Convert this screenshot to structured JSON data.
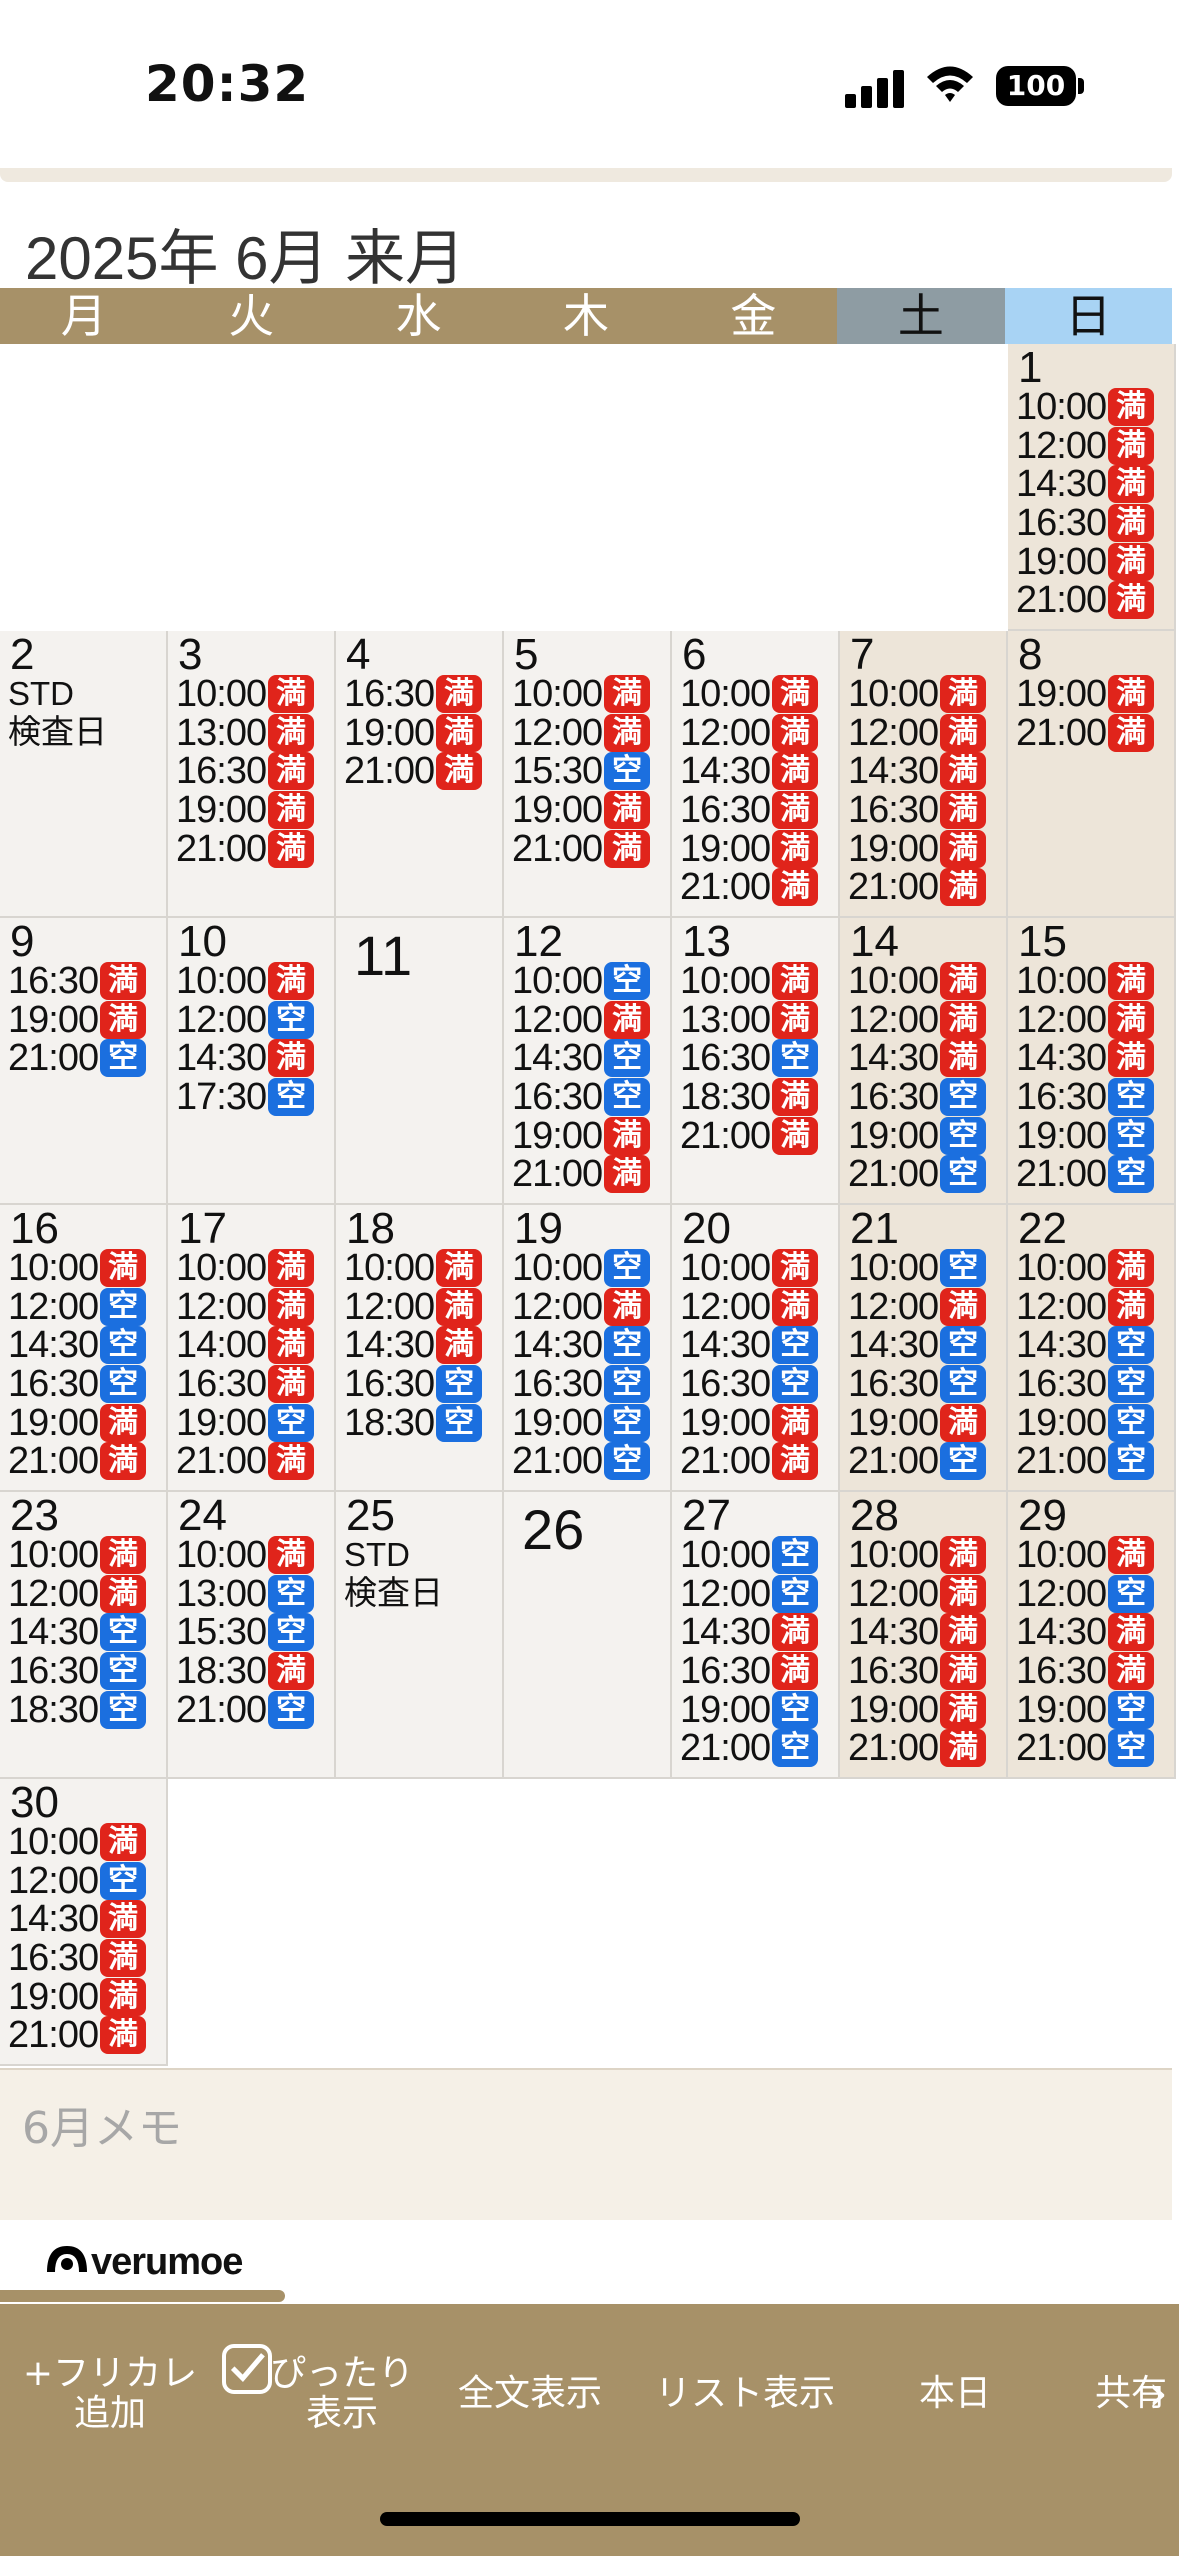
{
  "status": {
    "time": "20:32",
    "battery": "100"
  },
  "month_title": "2025年 6月 来月",
  "weekdays": [
    "月",
    "火",
    "水",
    "木",
    "金",
    "土",
    "日"
  ],
  "calendar": [
    {
      "day": "1",
      "col": 6,
      "row": 0,
      "slots": [
        [
          "10:00",
          "満"
        ],
        [
          "12:00",
          "満"
        ],
        [
          "14:30",
          "満"
        ],
        [
          "16:30",
          "満"
        ],
        [
          "19:00",
          "満"
        ],
        [
          "21:00",
          "満"
        ]
      ]
    },
    {
      "day": "2",
      "col": 0,
      "row": 1,
      "note": [
        "STD",
        "検査日"
      ],
      "slots": []
    },
    {
      "day": "3",
      "col": 1,
      "row": 1,
      "slots": [
        [
          "10:00",
          "満"
        ],
        [
          "13:00",
          "満"
        ],
        [
          "16:30",
          "満"
        ],
        [
          "19:00",
          "満"
        ],
        [
          "21:00",
          "満"
        ]
      ]
    },
    {
      "day": "4",
      "col": 2,
      "row": 1,
      "slots": [
        [
          "16:30",
          "満"
        ],
        [
          "19:00",
          "満"
        ],
        [
          "21:00",
          "満"
        ]
      ]
    },
    {
      "day": "5",
      "col": 3,
      "row": 1,
      "slots": [
        [
          "10:00",
          "満"
        ],
        [
          "12:00",
          "満"
        ],
        [
          "15:30",
          "空"
        ],
        [
          "19:00",
          "満"
        ],
        [
          "21:00",
          "満"
        ]
      ]
    },
    {
      "day": "6",
      "col": 4,
      "row": 1,
      "slots": [
        [
          "10:00",
          "満"
        ],
        [
          "12:00",
          "満"
        ],
        [
          "14:30",
          "満"
        ],
        [
          "16:30",
          "満"
        ],
        [
          "19:00",
          "満"
        ],
        [
          "21:00",
          "満"
        ]
      ]
    },
    {
      "day": "7",
      "col": 5,
      "row": 1,
      "slots": [
        [
          "10:00",
          "満"
        ],
        [
          "12:00",
          "満"
        ],
        [
          "14:30",
          "満"
        ],
        [
          "16:30",
          "満"
        ],
        [
          "19:00",
          "満"
        ],
        [
          "21:00",
          "満"
        ]
      ]
    },
    {
      "day": "8",
      "col": 6,
      "row": 1,
      "slots": [
        [
          "19:00",
          "満"
        ],
        [
          "21:00",
          "満"
        ]
      ]
    },
    {
      "day": "9",
      "col": 0,
      "row": 2,
      "slots": [
        [
          "16:30",
          "満"
        ],
        [
          "19:00",
          "満"
        ],
        [
          "21:00",
          "空"
        ]
      ]
    },
    {
      "day": "10",
      "col": 1,
      "row": 2,
      "slots": [
        [
          "10:00",
          "満"
        ],
        [
          "12:00",
          "空"
        ],
        [
          "14:30",
          "満"
        ],
        [
          "17:30",
          "空"
        ]
      ]
    },
    {
      "day": "11",
      "col": 2,
      "row": 2,
      "big": true,
      "slots": []
    },
    {
      "day": "12",
      "col": 3,
      "row": 2,
      "slots": [
        [
          "10:00",
          "空"
        ],
        [
          "12:00",
          "満"
        ],
        [
          "14:30",
          "空"
        ],
        [
          "16:30",
          "空"
        ],
        [
          "19:00",
          "満"
        ],
        [
          "21:00",
          "満"
        ]
      ]
    },
    {
      "day": "13",
      "col": 4,
      "row": 2,
      "slots": [
        [
          "10:00",
          "満"
        ],
        [
          "13:00",
          "満"
        ],
        [
          "16:30",
          "空"
        ],
        [
          "18:30",
          "満"
        ],
        [
          "21:00",
          "満"
        ]
      ]
    },
    {
      "day": "14",
      "col": 5,
      "row": 2,
      "slots": [
        [
          "10:00",
          "満"
        ],
        [
          "12:00",
          "満"
        ],
        [
          "14:30",
          "満"
        ],
        [
          "16:30",
          "空"
        ],
        [
          "19:00",
          "空"
        ],
        [
          "21:00",
          "空"
        ]
      ]
    },
    {
      "day": "15",
      "col": 6,
      "row": 2,
      "slots": [
        [
          "10:00",
          "満"
        ],
        [
          "12:00",
          "満"
        ],
        [
          "14:30",
          "満"
        ],
        [
          "16:30",
          "空"
        ],
        [
          "19:00",
          "空"
        ],
        [
          "21:00",
          "空"
        ]
      ]
    },
    {
      "day": "16",
      "col": 0,
      "row": 3,
      "slots": [
        [
          "10:00",
          "満"
        ],
        [
          "12:00",
          "空"
        ],
        [
          "14:30",
          "空"
        ],
        [
          "16:30",
          "空"
        ],
        [
          "19:00",
          "満"
        ],
        [
          "21:00",
          "満"
        ]
      ]
    },
    {
      "day": "17",
      "col": 1,
      "row": 3,
      "slots": [
        [
          "10:00",
          "満"
        ],
        [
          "12:00",
          "満"
        ],
        [
          "14:00",
          "満"
        ],
        [
          "16:30",
          "満"
        ],
        [
          "19:00",
          "空"
        ],
        [
          "21:00",
          "満"
        ]
      ]
    },
    {
      "day": "18",
      "col": 2,
      "row": 3,
      "slots": [
        [
          "10:00",
          "満"
        ],
        [
          "12:00",
          "満"
        ],
        [
          "14:30",
          "満"
        ],
        [
          "16:30",
          "空"
        ],
        [
          "18:30",
          "空"
        ]
      ]
    },
    {
      "day": "19",
      "col": 3,
      "row": 3,
      "slots": [
        [
          "10:00",
          "空"
        ],
        [
          "12:00",
          "満"
        ],
        [
          "14:30",
          "空"
        ],
        [
          "16:30",
          "空"
        ],
        [
          "19:00",
          "空"
        ],
        [
          "21:00",
          "空"
        ]
      ]
    },
    {
      "day": "20",
      "col": 4,
      "row": 3,
      "slots": [
        [
          "10:00",
          "満"
        ],
        [
          "12:00",
          "満"
        ],
        [
          "14:30",
          "空"
        ],
        [
          "16:30",
          "空"
        ],
        [
          "19:00",
          "満"
        ],
        [
          "21:00",
          "満"
        ]
      ]
    },
    {
      "day": "21",
      "col": 5,
      "row": 3,
      "slots": [
        [
          "10:00",
          "空"
        ],
        [
          "12:00",
          "満"
        ],
        [
          "14:30",
          "空"
        ],
        [
          "16:30",
          "空"
        ],
        [
          "19:00",
          "満"
        ],
        [
          "21:00",
          "空"
        ]
      ]
    },
    {
      "day": "22",
      "col": 6,
      "row": 3,
      "slots": [
        [
          "10:00",
          "満"
        ],
        [
          "12:00",
          "満"
        ],
        [
          "14:30",
          "空"
        ],
        [
          "16:30",
          "空"
        ],
        [
          "19:00",
          "空"
        ],
        [
          "21:00",
          "空"
        ]
      ]
    },
    {
      "day": "23",
      "col": 0,
      "row": 4,
      "slots": [
        [
          "10:00",
          "満"
        ],
        [
          "12:00",
          "満"
        ],
        [
          "14:30",
          "空"
        ],
        [
          "16:30",
          "空"
        ],
        [
          "18:30",
          "空"
        ]
      ]
    },
    {
      "day": "24",
      "col": 1,
      "row": 4,
      "slots": [
        [
          "10:00",
          "満"
        ],
        [
          "13:00",
          "空"
        ],
        [
          "15:30",
          "空"
        ],
        [
          "18:30",
          "満"
        ],
        [
          "21:00",
          "空"
        ]
      ]
    },
    {
      "day": "25",
      "col": 2,
      "row": 4,
      "note": [
        "STD",
        "検査日"
      ],
      "slots": []
    },
    {
      "day": "26",
      "col": 3,
      "row": 4,
      "big": true,
      "slots": []
    },
    {
      "day": "27",
      "col": 4,
      "row": 4,
      "slots": [
        [
          "10:00",
          "空"
        ],
        [
          "12:00",
          "空"
        ],
        [
          "14:30",
          "満"
        ],
        [
          "16:30",
          "満"
        ],
        [
          "19:00",
          "空"
        ],
        [
          "21:00",
          "空"
        ]
      ]
    },
    {
      "day": "28",
      "col": 5,
      "row": 4,
      "slots": [
        [
          "10:00",
          "満"
        ],
        [
          "12:00",
          "満"
        ],
        [
          "14:30",
          "満"
        ],
        [
          "16:30",
          "満"
        ],
        [
          "19:00",
          "満"
        ],
        [
          "21:00",
          "満"
        ]
      ]
    },
    {
      "day": "29",
      "col": 6,
      "row": 4,
      "slots": [
        [
          "10:00",
          "満"
        ],
        [
          "12:00",
          "空"
        ],
        [
          "14:30",
          "満"
        ],
        [
          "16:30",
          "満"
        ],
        [
          "19:00",
          "空"
        ],
        [
          "21:00",
          "空"
        ]
      ]
    },
    {
      "day": "30",
      "col": 0,
      "row": 5,
      "slots": [
        [
          "10:00",
          "満"
        ],
        [
          "12:00",
          "空"
        ],
        [
          "14:30",
          "満"
        ],
        [
          "16:30",
          "満"
        ],
        [
          "19:00",
          "満"
        ],
        [
          "21:00",
          "満"
        ]
      ]
    }
  ],
  "memo": {
    "label": "6月メモ"
  },
  "logo": {
    "text": "verumoe"
  },
  "toolbar": {
    "add_fricale_line1": "+フリカレ",
    "add_fricale_line2": "追加",
    "fit_line1": "ぴったり",
    "fit_line2": "表示",
    "full_text": "全文表示",
    "list_view": "リスト表示",
    "today": "本日",
    "share": "共有"
  },
  "colors": {
    "full": "#e0241b",
    "free": "#1b6fdf",
    "accent": "#a79168"
  }
}
